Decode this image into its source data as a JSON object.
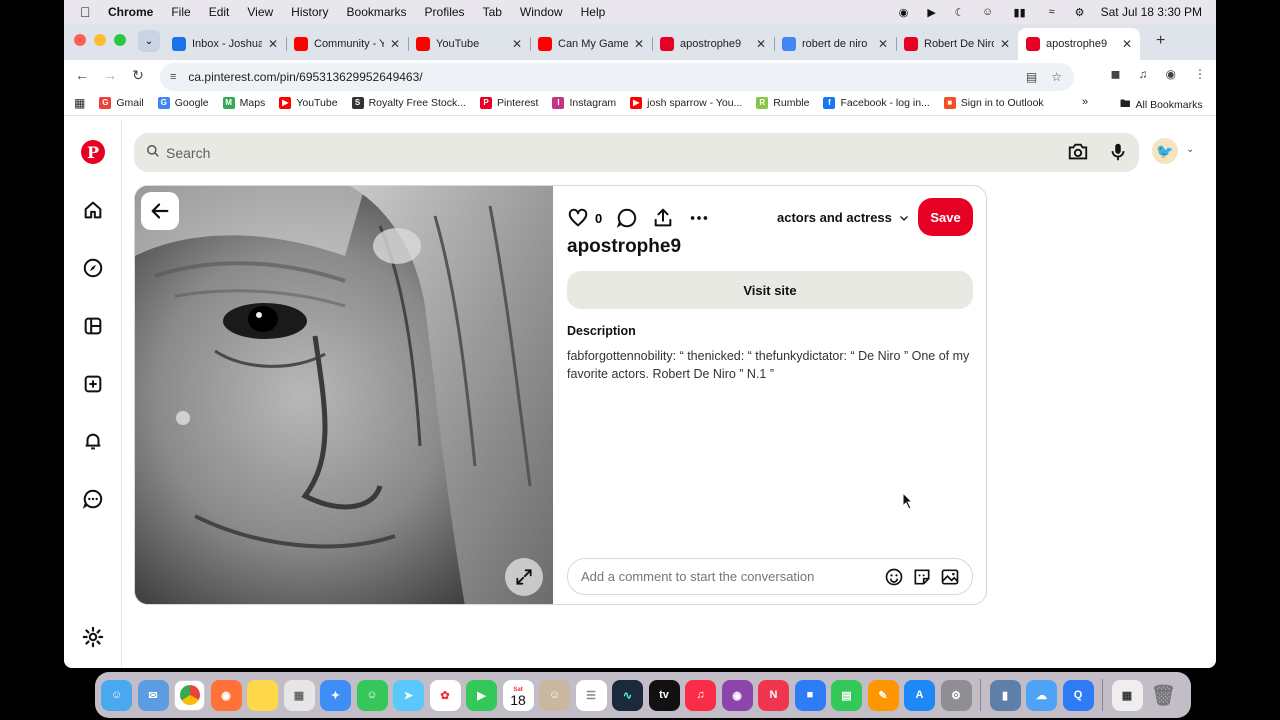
{
  "menubar": {
    "app": "Chrome",
    "items": [
      "File",
      "Edit",
      "View",
      "History",
      "Bookmarks",
      "Profiles",
      "Tab",
      "Window",
      "Help"
    ],
    "datetime": "Sat Jul 18  3:30 PM"
  },
  "tabs": [
    {
      "label": "Inbox - Joshua",
      "color": "#1a73e8",
      "icon": "outlook-icon"
    },
    {
      "label": "Community - Y",
      "color": "#ff0000",
      "icon": "youtube-icon"
    },
    {
      "label": "YouTube",
      "color": "#ff0000",
      "icon": "youtube-icon"
    },
    {
      "label": "Can My Game",
      "color": "#ff0000",
      "icon": "youtube-icon"
    },
    {
      "label": "apostrophe9",
      "color": "#e60023",
      "icon": "pinterest-icon"
    },
    {
      "label": "robert de niro",
      "color": "#4285f4",
      "icon": "google-icon"
    },
    {
      "label": "Robert De Niro",
      "color": "#e60023",
      "icon": "pinterest-icon"
    },
    {
      "label": "apostrophe9",
      "color": "#e60023",
      "icon": "pinterest-icon",
      "active": true
    }
  ],
  "address": {
    "url": "ca.pinterest.com/pin/695313629952649463/"
  },
  "bookmarks": [
    {
      "label": "Gmail",
      "glyph": "G",
      "color": "#ea4335"
    },
    {
      "label": "Google",
      "glyph": "G",
      "color": "#4285f4"
    },
    {
      "label": "Maps",
      "glyph": "M",
      "color": "#34a853"
    },
    {
      "label": "YouTube",
      "glyph": "▶",
      "color": "#ff0000"
    },
    {
      "label": "Royalty Free Stock...",
      "glyph": "S",
      "color": "#333333"
    },
    {
      "label": "Pinterest",
      "glyph": "P",
      "color": "#e60023"
    },
    {
      "label": "Instagram",
      "glyph": "I",
      "color": "#c13584"
    },
    {
      "label": "josh sparrow - You...",
      "glyph": "▶",
      "color": "#ff0000"
    },
    {
      "label": "Rumble",
      "glyph": "R",
      "color": "#85c742"
    },
    {
      "label": "Facebook - log in...",
      "glyph": "f",
      "color": "#1877f2"
    },
    {
      "label": "Sign in to Outlook",
      "glyph": "■",
      "color": "#f25022"
    }
  ],
  "bookmarks_all": "All Bookmarks",
  "search": {
    "placeholder": "Search"
  },
  "pin": {
    "like_count": "0",
    "board": "actors and actress",
    "save_label": "Save",
    "title": "apostrophe9",
    "visit_label": "Visit site",
    "description_heading": "Description",
    "description": "fabforgottennobility: “ thenicked: “ thefunkydictator: “ De Niro ” One of my favorite actors. Robert De Niro ” N.1 ”",
    "comment_placeholder": "Add a comment to start the conversation"
  },
  "colors": {
    "pinterest_red": "#e60023",
    "button_gray": "#e9e9e3"
  },
  "dock": {
    "calendar_month": "Sat",
    "calendar_day": "18"
  }
}
